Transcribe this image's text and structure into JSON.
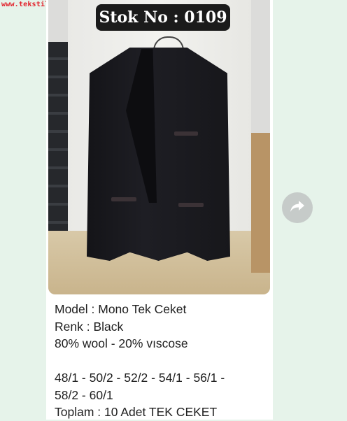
{
  "watermark": "www.tekstilportal.com",
  "post": {
    "stock_badge": "Stok No : 0109",
    "caption": {
      "model": "Model : Mono Tek Ceket",
      "color": "Renk  : Black",
      "fabric": "80% wool - 20% vıscose",
      "sizes_line1": "48/1 - 50/2 - 52/2 - 54/1 - 56/1 -",
      "sizes_line2": "58/2 - 60/1",
      "total": "Toplam : 10 Adet TEK CEKET"
    }
  },
  "icons": {
    "forward": "forward-share-icon"
  },
  "colors": {
    "background": "#e6f3ea",
    "bubble": "#ffffff",
    "watermark": "#e2202a",
    "badge": "#1b1b1b",
    "forward_button": "#c6cbc9"
  }
}
